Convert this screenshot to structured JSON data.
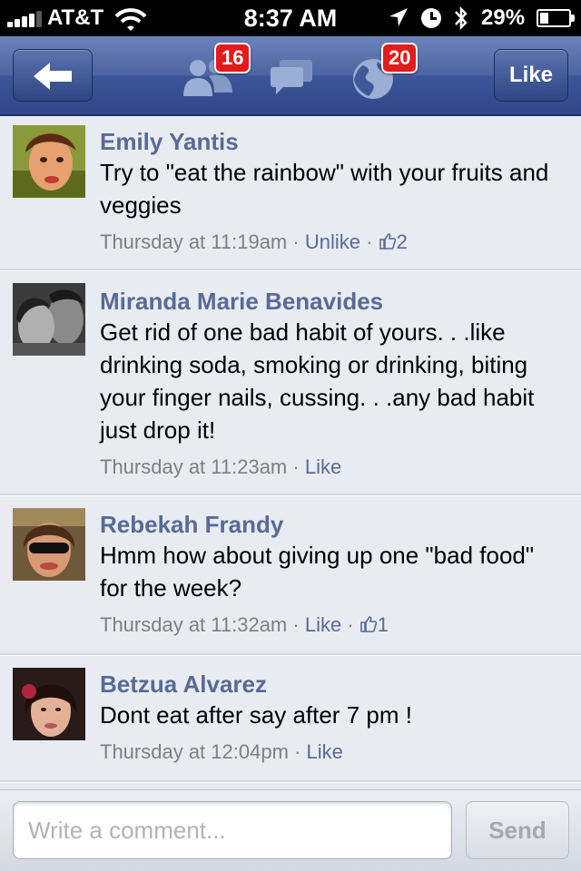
{
  "status_bar": {
    "carrier": "AT&T",
    "time": "8:37 AM",
    "battery_percent": "29%",
    "battery_level": 0.29,
    "signal_bars": 4,
    "icons": [
      "signal-icon",
      "wifi-icon",
      "location-arrow-icon",
      "clock-icon",
      "bluetooth-icon",
      "battery-icon"
    ]
  },
  "nav_bar": {
    "back_icon": "back-arrow-icon",
    "friend_requests_badge": "16",
    "messages_icon": "messages-icon",
    "notifications_badge": "20",
    "like_label": "Like"
  },
  "comments": [
    {
      "name": "Emily Yantis",
      "text": "Try to \"eat the rainbow\" with your fruits and veggies",
      "time": "Thursday at 11:19am",
      "action": "Unlike",
      "likes": "2"
    },
    {
      "name": "Miranda Marie Benavides",
      "text": "Get rid of one bad habit of yours. . .like drinking soda, smoking or drinking, biting your finger nails, cussing. . .any bad habit just drop it!",
      "time": "Thursday at 11:23am",
      "action": "Like",
      "likes": ""
    },
    {
      "name": "Rebekah Frandy",
      "text": "Hmm how about giving up one \"bad food\" for the week?",
      "time": "Thursday at 11:32am",
      "action": "Like",
      "likes": "1"
    },
    {
      "name": "Betzua Alvarez",
      "text": "Dont eat after say after 7 pm !",
      "time": "Thursday at 12:04pm",
      "action": "Like",
      "likes": ""
    }
  ],
  "meta_separator": "·",
  "compose": {
    "placeholder": "Write a comment...",
    "value": "",
    "send_label": "Send"
  },
  "colors": {
    "fb_blue": "#3b5998",
    "name_blue": "#576b95",
    "badge_red": "#e21b1b",
    "meta_gray": "#7f7f7f",
    "background": "#e9ebf2"
  }
}
